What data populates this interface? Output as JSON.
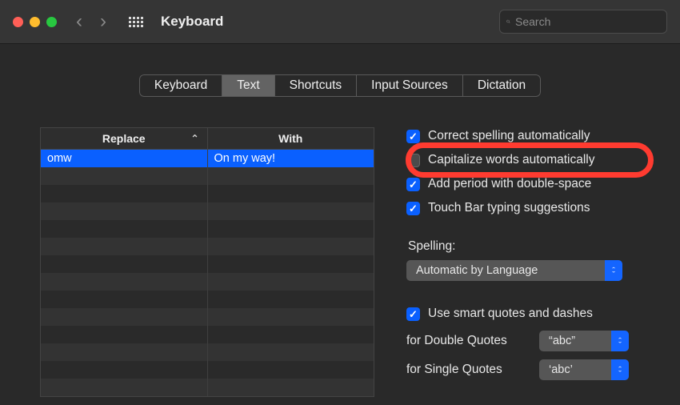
{
  "header": {
    "title": "Keyboard",
    "search_placeholder": "Search"
  },
  "tabs": [
    {
      "label": "Keyboard",
      "active": false
    },
    {
      "label": "Text",
      "active": true
    },
    {
      "label": "Shortcuts",
      "active": false
    },
    {
      "label": "Input Sources",
      "active": false
    },
    {
      "label": "Dictation",
      "active": false
    }
  ],
  "replace_table": {
    "columns": {
      "replace": "Replace",
      "with": "With"
    },
    "rows": [
      {
        "replace": "omw",
        "with": "On my way!",
        "selected": true
      }
    ]
  },
  "options": {
    "correct_spelling": {
      "label": "Correct spelling automatically",
      "checked": true
    },
    "capitalize": {
      "label": "Capitalize words automatically",
      "checked": false
    },
    "add_period": {
      "label": "Add period with double-space",
      "checked": true
    },
    "touch_bar": {
      "label": "Touch Bar typing suggestions",
      "checked": true
    },
    "spelling_label": "Spelling:",
    "spelling_value": "Automatic by Language",
    "smart_quotes": {
      "label": "Use smart quotes and dashes",
      "checked": true
    },
    "double_quotes_label": "for Double Quotes",
    "double_quotes_value": "“abc”",
    "single_quotes_label": "for Single Quotes",
    "single_quotes_value": "‘abc’"
  }
}
